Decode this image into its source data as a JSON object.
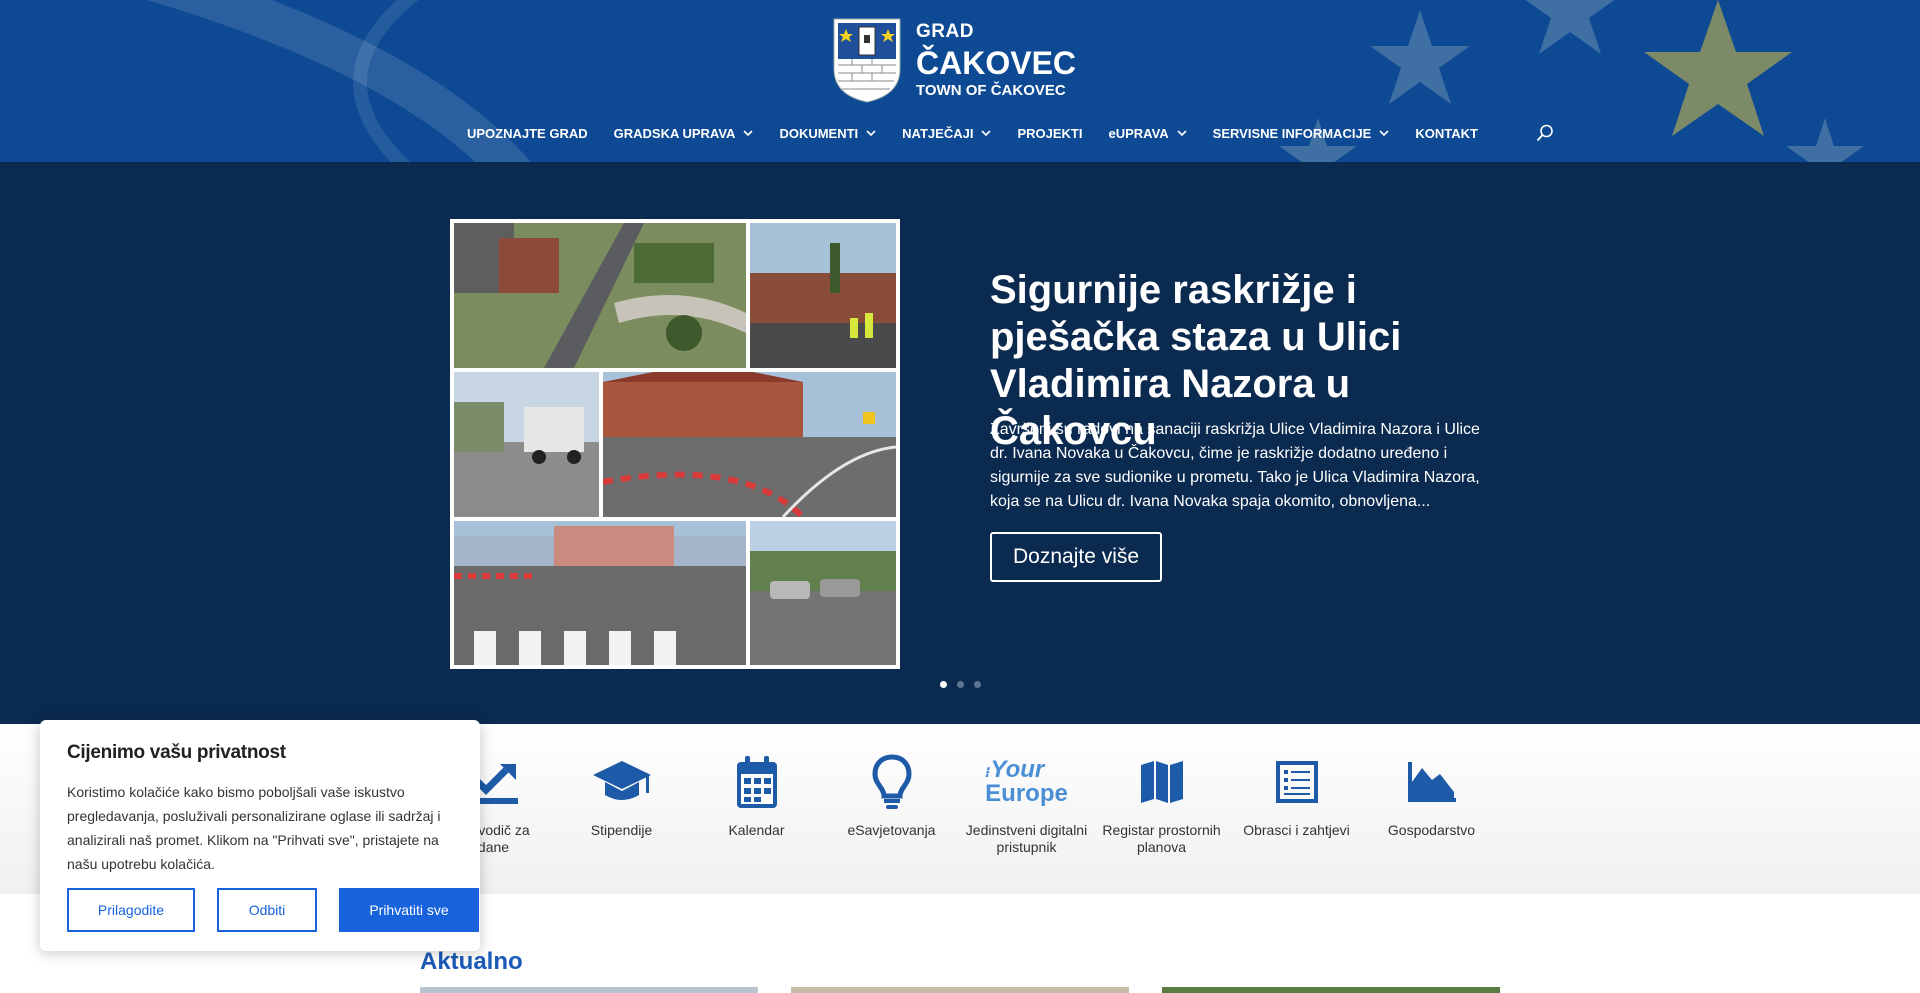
{
  "logo": {
    "line1": "GRAD",
    "line2": "ČAKOVEC",
    "line3": "TOWN OF ČAKOVEC"
  },
  "nav": [
    {
      "label": "UPOZNAJTE GRAD",
      "dropdown": false
    },
    {
      "label": "GRADSKA UPRAVA",
      "dropdown": true
    },
    {
      "label": "DOKUMENTI",
      "dropdown": true
    },
    {
      "label": "NATJEČAJI",
      "dropdown": true
    },
    {
      "label": "PROJEKTI",
      "dropdown": false
    },
    {
      "label": "eUPRAVA",
      "dropdown": true
    },
    {
      "label": "SERVISNE INFORMACIJE",
      "dropdown": true
    },
    {
      "label": "KONTAKT",
      "dropdown": false
    }
  ],
  "hero": {
    "title": "Sigurnije raskrižje i pješačka staza u Ulici Vladimira Nazora u Čakovcu",
    "description": "Završeni su radovi na sanaciji raskrižja Ulice Vladimira Nazora i Ulice dr. Ivana Novaka u Čakovcu, čime je raskrižje dodatno uređeno i sigurnije za sve sudionike u prometu. Tako je Ulica Vladimira Nazora, koja se na Ulicu dr. Ivana Novaka spaja okomito, obnovljena...",
    "button": "Doznajte više",
    "slides": 3,
    "active_slide": 1
  },
  "services": [
    {
      "label": "ski vodič za\ndane",
      "icon": "chart-arrow-icon"
    },
    {
      "label": "Stipendije",
      "icon": "graduation-cap-icon"
    },
    {
      "label": "Kalendar",
      "icon": "calendar-icon"
    },
    {
      "label": "eSavjetovanja",
      "icon": "lightbulb-icon"
    },
    {
      "label": "Jedinstveni digitalni\npristupnik",
      "icon": "your-europe-logo",
      "logo_text1": "Your",
      "logo_text2": "Europe"
    },
    {
      "label": "Registar prostornih\nplanova",
      "icon": "map-icon"
    },
    {
      "label": "Obrasci i zahtjevi",
      "icon": "form-icon"
    },
    {
      "label": "Gospodarstvo",
      "icon": "area-chart-icon"
    }
  ],
  "section": {
    "aktualno": "Aktualno"
  },
  "cookie": {
    "title": "Cijenimo vašu privatnost",
    "text": "Koristimo kolačiće kako bismo poboljšali vaše iskustvo pregledavanja, posluživali personalizirane oglase ili sadržaj i analizirali naš promet. Klikom na \"Prihvati sve\", pristajete na našu upotrebu kolačića.",
    "customize": "Prilagodite",
    "reject": "Odbiti",
    "accept": "Prihvatiti sve"
  },
  "colors": {
    "header": "#0d4a93",
    "hero": "#0b2a50",
    "accent": "#1863dc",
    "icon": "#1d5aa8"
  }
}
